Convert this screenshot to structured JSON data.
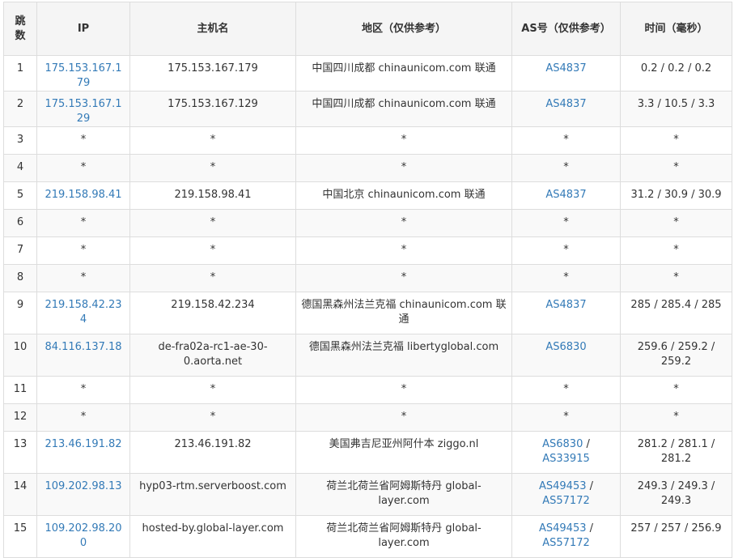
{
  "headers": {
    "hop": "跳数",
    "ip": "IP",
    "host": "主机名",
    "geo": "地区（仅供参考）",
    "as": "AS号（仅供参考）",
    "time": "时间（毫秒）"
  },
  "colors": {
    "link": "#337ab7",
    "border": "#dddddd",
    "header_bg": "#f5f5f5",
    "stripe_bg": "#f9f9f9"
  },
  "rows": [
    {
      "hop": "1",
      "ip": "175.153.167.179",
      "host": "175.153.167.179",
      "geo": "中国四川成都 chinaunicom.com 联通",
      "as": [
        "AS4837"
      ],
      "time": "0.2 / 0.2 / 0.2"
    },
    {
      "hop": "2",
      "ip": "175.153.167.129",
      "host": "175.153.167.129",
      "geo": "中国四川成都 chinaunicom.com 联通",
      "as": [
        "AS4837"
      ],
      "time": "3.3 / 10.5 / 3.3"
    },
    {
      "hop": "3",
      "ip": "*",
      "host": "*",
      "geo": "*",
      "as": [],
      "as_text": "*",
      "time": "*"
    },
    {
      "hop": "4",
      "ip": "*",
      "host": "*",
      "geo": "*",
      "as": [],
      "as_text": "*",
      "time": "*"
    },
    {
      "hop": "5",
      "ip": "219.158.98.41",
      "host": "219.158.98.41",
      "geo": "中国北京 chinaunicom.com 联通",
      "as": [
        "AS4837"
      ],
      "time": "31.2 / 30.9 / 30.9"
    },
    {
      "hop": "6",
      "ip": "*",
      "host": "*",
      "geo": "*",
      "as": [],
      "as_text": "*",
      "time": "*"
    },
    {
      "hop": "7",
      "ip": "*",
      "host": "*",
      "geo": "*",
      "as": [],
      "as_text": "*",
      "time": "*"
    },
    {
      "hop": "8",
      "ip": "*",
      "host": "*",
      "geo": "*",
      "as": [],
      "as_text": "*",
      "time": "*"
    },
    {
      "hop": "9",
      "ip": "219.158.42.234",
      "host": "219.158.42.234",
      "geo": "德国黑森州法兰克福 chinaunicom.com 联通",
      "as": [
        "AS4837"
      ],
      "time": "285 / 285.4 / 285"
    },
    {
      "hop": "10",
      "ip": "84.116.137.18",
      "host": "de-fra02a-rc1-ae-30-0.aorta.net",
      "geo": "德国黑森州法兰克福 libertyglobal.com",
      "as": [
        "AS6830"
      ],
      "time": "259.6 / 259.2 / 259.2"
    },
    {
      "hop": "11",
      "ip": "*",
      "host": "*",
      "geo": "*",
      "as": [],
      "as_text": "*",
      "time": "*"
    },
    {
      "hop": "12",
      "ip": "*",
      "host": "*",
      "geo": "*",
      "as": [],
      "as_text": "*",
      "time": "*"
    },
    {
      "hop": "13",
      "ip": "213.46.191.82",
      "host": "213.46.191.82",
      "geo": "美国弗吉尼亚州阿什本 ziggo.nl",
      "as": [
        "AS6830",
        "AS33915"
      ],
      "time": "281.2 / 281.1 / 281.2"
    },
    {
      "hop": "14",
      "ip": "109.202.98.13",
      "host": "hyp03-rtm.serverboost.com",
      "geo": "荷兰北荷兰省阿姆斯特丹 global-layer.com",
      "as": [
        "AS49453",
        "AS57172"
      ],
      "time": "249.3 / 249.3 / 249.3"
    },
    {
      "hop": "15",
      "ip": "109.202.98.200",
      "host": "hosted-by.global-layer.com",
      "geo": "荷兰北荷兰省阿姆斯特丹 global-layer.com",
      "as": [
        "AS49453",
        "AS57172"
      ],
      "time": "257 / 257 / 256.9"
    }
  ]
}
